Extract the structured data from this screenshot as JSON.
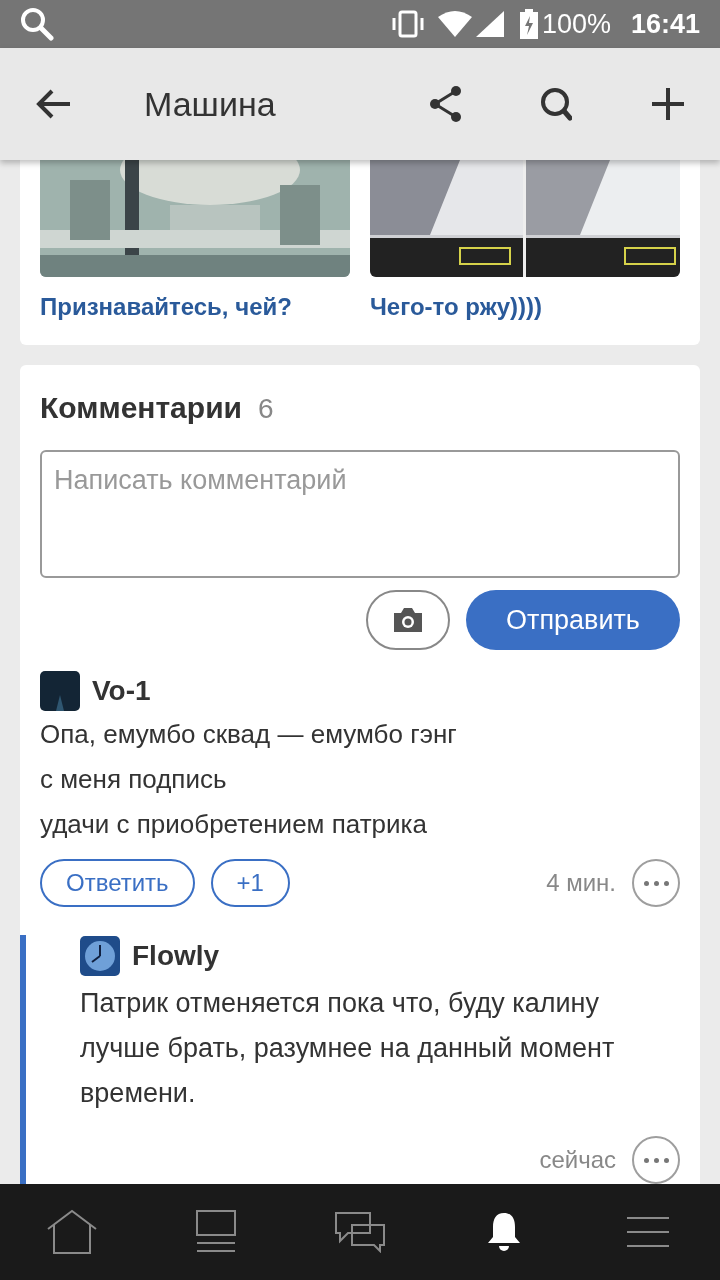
{
  "status_bar": {
    "battery": "100%",
    "time": "16:41"
  },
  "app_bar": {
    "title": "Машина"
  },
  "related_posts": [
    {
      "kind": "picture",
      "title": "Признавайтесь, чей?"
    },
    {
      "kind": "picture",
      "title": "Чего-то ржу))))"
    }
  ],
  "comments": {
    "title": "Комментарии",
    "count": "6",
    "input": {
      "placeholder": "Написать комментарий"
    },
    "send_button": "Отправить",
    "items": [
      {
        "author": "Vo-1",
        "lines": [
          "Опа, емумбо сквад — емумбо гэнг",
          "с меня подпись",
          "удачи с приобретением патрика"
        ],
        "reply_button": "Ответить",
        "plus_button": "+1",
        "time": "4 мин.",
        "children": [
          {
            "author": "Flowly",
            "lines": [
              "Патрик отменяется пока что, буду калину лучше брать, разумнее на данный момент времени."
            ],
            "time": "сейчас"
          }
        ]
      }
    ]
  },
  "bottom_nav": [
    {
      "kind": "home",
      "selected": false
    },
    {
      "kind": "feed",
      "selected": false
    },
    {
      "kind": "messages",
      "selected": false
    },
    {
      "kind": "notifications",
      "selected": true
    },
    {
      "kind": "menu",
      "selected": false
    }
  ]
}
